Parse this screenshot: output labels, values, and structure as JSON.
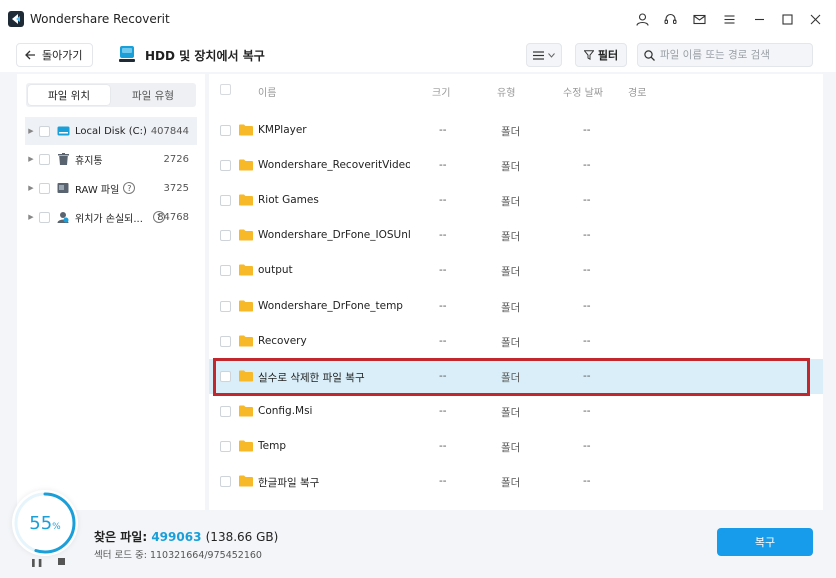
{
  "window": {
    "title": "Wondershare Recoverit"
  },
  "toolbar": {
    "back_label": "돌아가기",
    "page_title": "HDD 및 장치에서 복구",
    "filter_label": "필터",
    "search_placeholder": "파일 이름 또는 경로 검색"
  },
  "sidebar": {
    "tabs": [
      {
        "label": "파일 위치",
        "active": true
      },
      {
        "label": "파일 유형",
        "active": false
      }
    ],
    "items": [
      {
        "label": "Local Disk (C:)",
        "count": "407844",
        "icon": "drive-icon",
        "selected": true
      },
      {
        "label": "휴지통",
        "count": "2726",
        "icon": "trash-icon",
        "selected": false
      },
      {
        "label": "RAW 파일",
        "count": "3725",
        "icon": "raw-file-icon",
        "help": "?",
        "selected": false
      },
      {
        "label": "위치가 손실되...",
        "count": "84768",
        "icon": "lost-location-icon",
        "help": "?",
        "selected": false
      }
    ]
  },
  "table": {
    "columns": {
      "name": "이름",
      "size": "크기",
      "type": "유형",
      "modified": "수정 날짜",
      "path": "경로"
    },
    "rows": [
      {
        "name": "KMPlayer",
        "size": "--",
        "type": "폴더",
        "date": "--"
      },
      {
        "name": "Wondershare_RecoveritVideoR...",
        "size": "--",
        "type": "폴더",
        "date": "--"
      },
      {
        "name": "Riot Games",
        "size": "--",
        "type": "폴더",
        "date": "--"
      },
      {
        "name": "Wondershare_DrFone_IOSUnlock",
        "size": "--",
        "type": "폴더",
        "date": "--"
      },
      {
        "name": "output",
        "size": "--",
        "type": "폴더",
        "date": "--"
      },
      {
        "name": "Wondershare_DrFone_temp",
        "size": "--",
        "type": "폴더",
        "date": "--"
      },
      {
        "name": "Recovery",
        "size": "--",
        "type": "폴더",
        "date": "--"
      },
      {
        "name": "실수로 삭제한 파일 복구",
        "size": "--",
        "type": "폴더",
        "date": "--",
        "highlighted": true
      },
      {
        "name": "Config.Msi",
        "size": "--",
        "type": "폴더",
        "date": "--"
      },
      {
        "name": "Temp",
        "size": "--",
        "type": "폴더",
        "date": "--"
      },
      {
        "name": "한글파일 복구",
        "size": "--",
        "type": "폴더",
        "date": "--"
      }
    ]
  },
  "footer": {
    "progress_value": "55",
    "progress_unit": "%",
    "found_label": "찾은 파일:",
    "found_count": "499063",
    "found_size": "(138.66 GB)",
    "sector_text": "섹터 로드 중: 110321664/975452160",
    "recover_label": "복구"
  },
  "colors": {
    "accent": "#169cea",
    "highlight_row": "#d9eef8",
    "annotation_border": "#c2272d",
    "folder": "#f7b928"
  }
}
